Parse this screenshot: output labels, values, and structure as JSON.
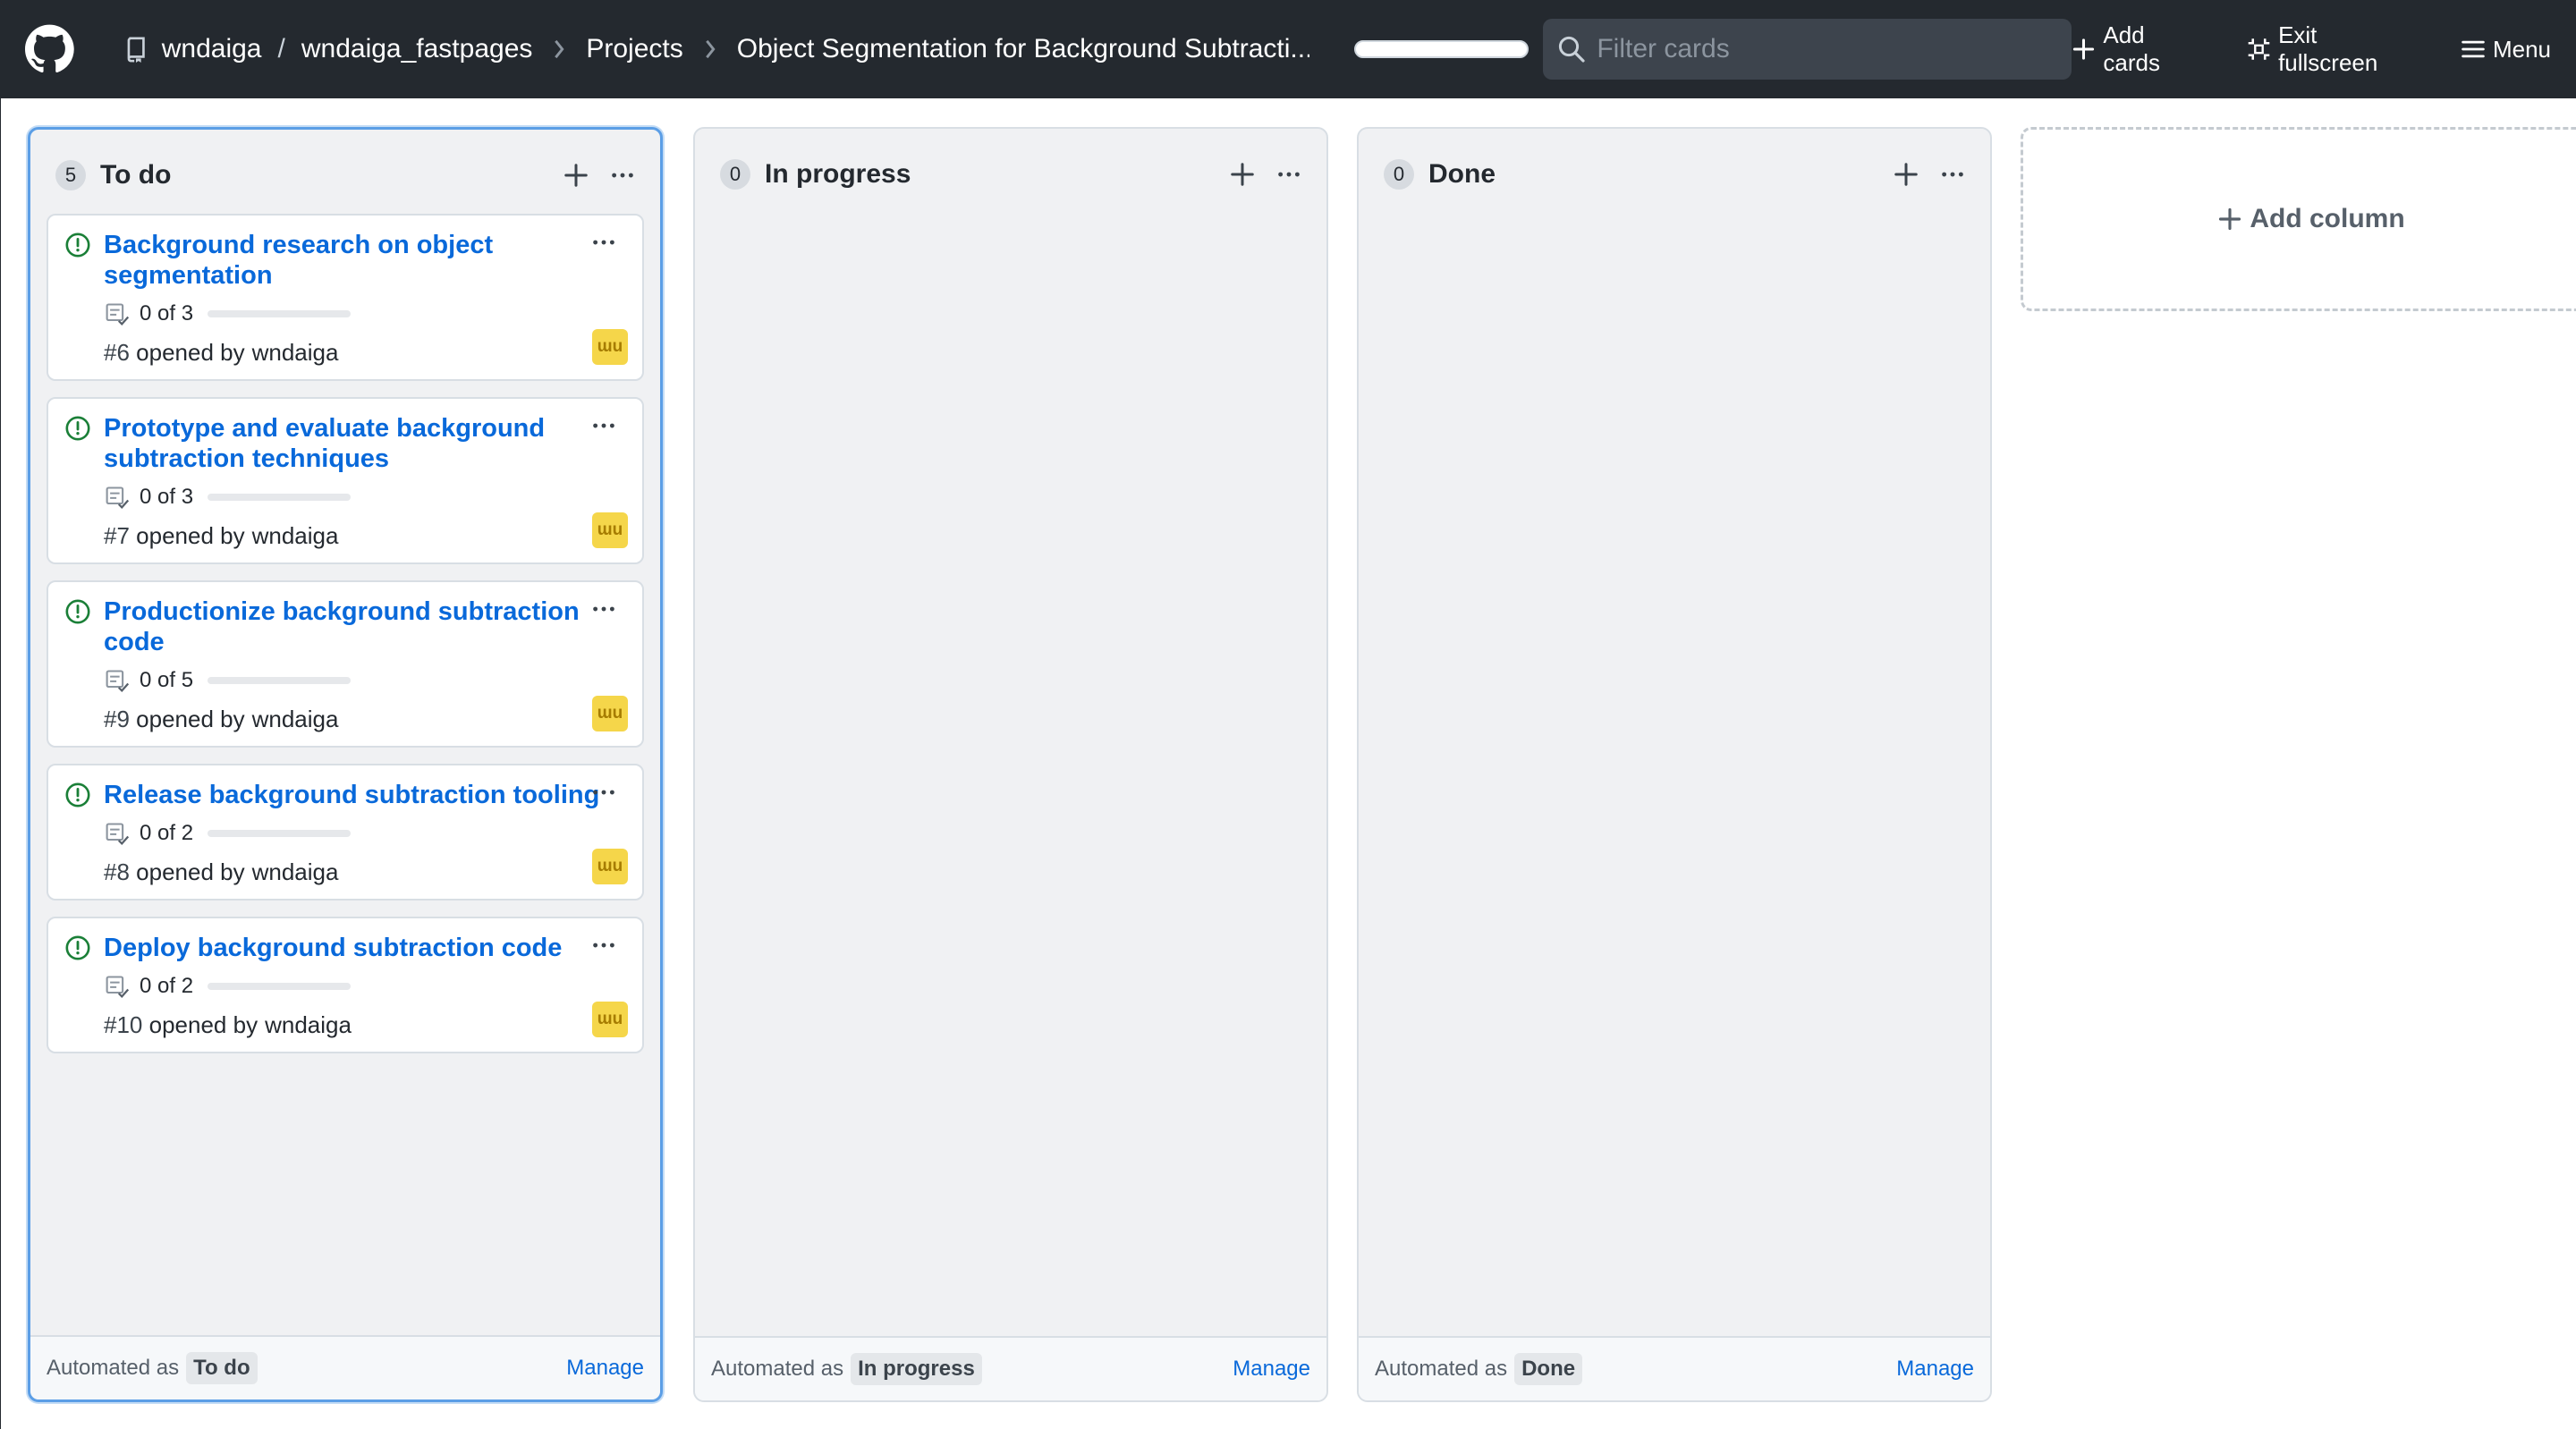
{
  "header": {
    "owner": "wndaiga",
    "separator": "/",
    "repo": "wndaiga_fastpages",
    "projects": "Projects",
    "project_title": "Object Segmentation for Background Subtracti...",
    "search_placeholder": "Filter cards",
    "add_cards": "Add cards",
    "exit_fullscreen": "Exit fullscreen",
    "menu": "Menu"
  },
  "columns": [
    {
      "name": "To do",
      "count": "5",
      "automated_label": "Automated as",
      "automated_tag": "To do",
      "manage": "Manage",
      "cards": [
        {
          "title": "Background research on object segmentation",
          "tasks": "0 of 3",
          "number": "#6",
          "opened_by": "opened by",
          "user": "wndaiga",
          "progress": 0
        },
        {
          "title": "Prototype and evaluate background subtraction techniques",
          "tasks": "0 of 3",
          "number": "#7",
          "opened_by": "opened by",
          "user": "wndaiga",
          "progress": 0
        },
        {
          "title": "Productionize background subtraction code",
          "tasks": "0 of 5",
          "number": "#9",
          "opened_by": "opened by",
          "user": "wndaiga",
          "progress": 0
        },
        {
          "title": "Release background subtraction tooling",
          "tasks": "0 of 2",
          "number": "#8",
          "opened_by": "opened by",
          "user": "wndaiga",
          "progress": 0
        },
        {
          "title": "Deploy background subtraction code",
          "tasks": "0 of 2",
          "number": "#10",
          "opened_by": "opened by",
          "user": "wndaiga",
          "progress": 0
        }
      ]
    },
    {
      "name": "In progress",
      "count": "0",
      "automated_label": "Automated as",
      "automated_tag": "In progress",
      "manage": "Manage"
    },
    {
      "name": "Done",
      "count": "0",
      "automated_label": "Automated as",
      "automated_tag": "Done",
      "manage": "Manage"
    }
  ],
  "add_column": "Add column",
  "avatar_text": "ɯu",
  "colors": {
    "accent": "#0969da",
    "issue_open": "#1a7f37",
    "header_bg": "#24292f",
    "avatar_bg": "#f5d64a"
  }
}
